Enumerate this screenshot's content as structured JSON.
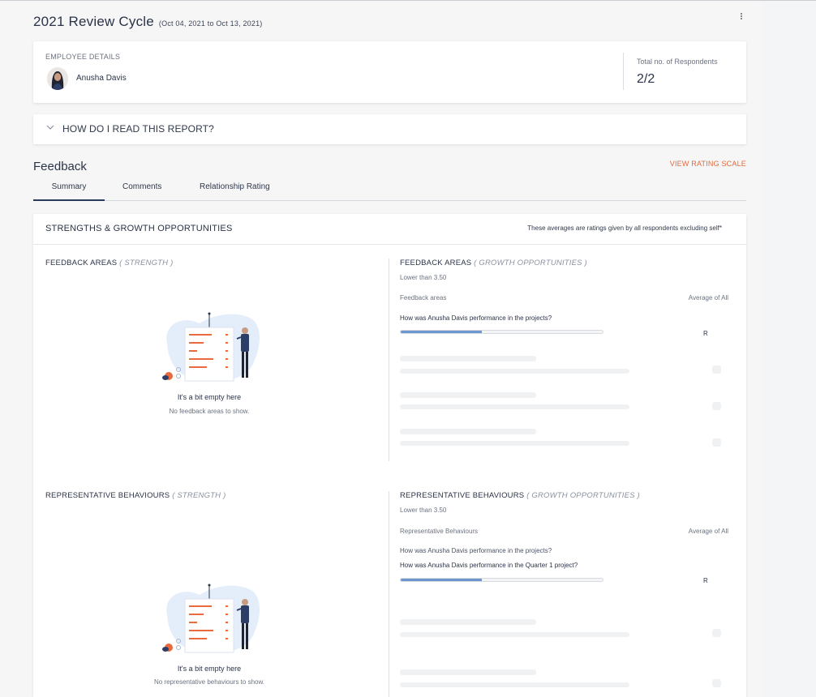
{
  "header": {
    "title": "2021 Review Cycle",
    "date_range": "(Oct 04, 2021 to Oct 13, 2021)"
  },
  "employee": {
    "section_label": "EMPLOYEE DETAILS",
    "name": "Anusha Davis",
    "respondents_label": "Total no. of Respondents",
    "respondents_value": "2/2"
  },
  "howto": {
    "label": "HOW DO I READ THIS REPORT?"
  },
  "feedback": {
    "title": "Feedback",
    "view_rating_scale": "VIEW RATING SCALE",
    "tabs": [
      {
        "label": "Summary",
        "active": true
      },
      {
        "label": "Comments",
        "active": false
      },
      {
        "label": "Relationship Rating",
        "active": false
      }
    ]
  },
  "summary": {
    "title": "STRENGTHS & GROWTH OPPORTUNITIES",
    "note": "These averages are ratings given by all respondents excluding self*",
    "feedback_strength": {
      "title": "FEEDBACK AREAS",
      "qualifier": "( STRENGTH )",
      "empty_title": "It's a bit empty here",
      "empty_sub": "No feedback areas to show."
    },
    "feedback_growth": {
      "title": "FEEDBACK AREAS",
      "qualifier": "( GROWTH OPPORTUNITIES )",
      "threshold": "Lower than 3.50",
      "col_left": "Feedback areas",
      "col_right": "Average of All",
      "items": [
        {
          "question": "How was Anusha Davis performance in the projects?",
          "progress": 0.4,
          "rating": "R"
        }
      ]
    },
    "behaviour_strength": {
      "title": "REPRESENTATIVE BEHAVIOURS",
      "qualifier": "( STRENGTH )",
      "empty_title": "It's a bit empty here",
      "empty_sub": "No representative behaviours to show."
    },
    "behaviour_growth": {
      "title": "REPRESENTATIVE BEHAVIOURS",
      "qualifier": "( GROWTH OPPORTUNITIES )",
      "threshold": "Lower than 3.50",
      "col_left": "Representative Behaviours",
      "col_right": "Average of All",
      "parent_question": "How was Anusha Davis performance in the projects?",
      "items": [
        {
          "question": "How was Anusha Davis performance in the Quarter 1 project?",
          "progress": 0.4,
          "rating": "R"
        }
      ]
    }
  },
  "colors": {
    "accent_orange": "#e26a3c",
    "progress_blue": "#6e96cf",
    "text_dark": "#2a3347"
  }
}
